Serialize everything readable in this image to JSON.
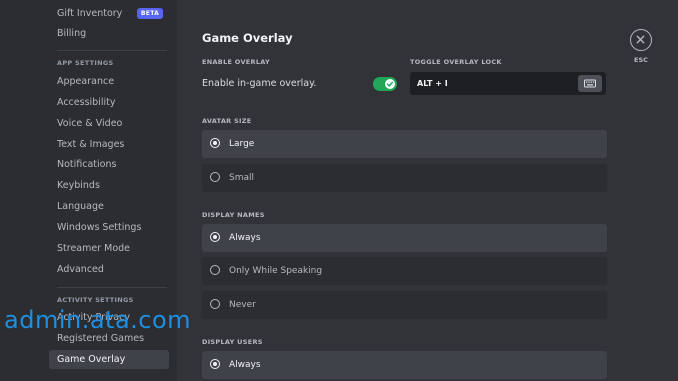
{
  "sidebar": {
    "top_items": [
      {
        "label": "Gift Inventory",
        "badge": "BETA"
      },
      {
        "label": "Billing"
      }
    ],
    "app_settings_header": "APP SETTINGS",
    "app_settings_items": [
      {
        "label": "Appearance"
      },
      {
        "label": "Accessibility"
      },
      {
        "label": "Voice & Video"
      },
      {
        "label": "Text & Images"
      },
      {
        "label": "Notifications"
      },
      {
        "label": "Keybinds"
      },
      {
        "label": "Language"
      },
      {
        "label": "Windows Settings"
      },
      {
        "label": "Streamer Mode"
      },
      {
        "label": "Advanced"
      }
    ],
    "activity_settings_header": "ACTIVITY SETTINGS",
    "activity_settings_items": [
      {
        "label": "Activity Privacy"
      },
      {
        "label": "Registered Games"
      },
      {
        "label": "Game Overlay",
        "selected": true
      }
    ]
  },
  "main": {
    "title": "Game Overlay",
    "enable_overlay": {
      "section_label": "ENABLE OVERLAY",
      "text": "Enable in-game overlay.",
      "enabled": true
    },
    "toggle_lock": {
      "section_label": "TOGGLE OVERLAY LOCK",
      "value": "ALT + I",
      "icon": "keyboard-icon"
    },
    "avatar_size": {
      "section_label": "AVATAR SIZE",
      "options": [
        {
          "label": "Large",
          "selected": true
        },
        {
          "label": "Small",
          "selected": false
        }
      ]
    },
    "display_names": {
      "section_label": "DISPLAY NAMES",
      "options": [
        {
          "label": "Always",
          "selected": true
        },
        {
          "label": "Only While Speaking",
          "selected": false
        },
        {
          "label": "Never",
          "selected": false
        }
      ]
    },
    "display_users": {
      "section_label": "DISPLAY USERS",
      "options": [
        {
          "label": "Always",
          "selected": true
        }
      ]
    }
  },
  "close": {
    "icon": "close-icon",
    "label": "ESC"
  },
  "watermark": "admin.ata.com",
  "colors": {
    "accent_green": "#23a55a",
    "badge_blurple": "#5865f2",
    "watermark_blue": "#1e8fe0"
  }
}
